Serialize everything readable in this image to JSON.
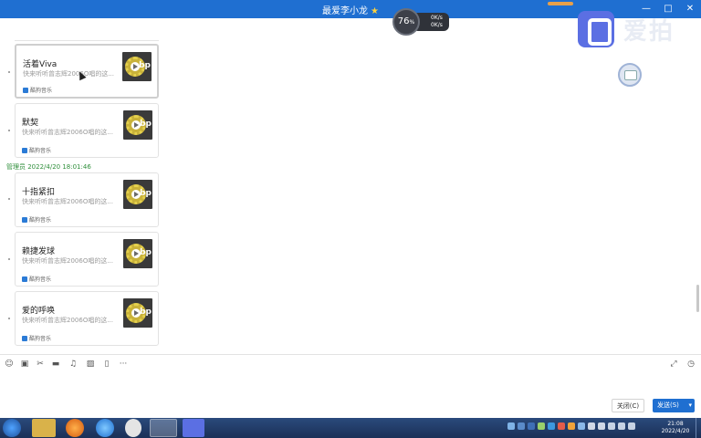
{
  "window": {
    "title": "最爱李小龙",
    "star": "★",
    "controls": [
      "—",
      "□",
      "✕"
    ]
  },
  "speed_widget": {
    "value": "76",
    "unit": "%",
    "up": "0K/s",
    "down": "0K/s"
  },
  "brand": {
    "name": "爱拍"
  },
  "chat": {
    "sender_time": "管理员 2022/4/20 18:01:46",
    "cards": [
      {
        "title": "活着Viva",
        "desc": "快来听听曾志辉2006O唱的这...",
        "source": "酷狗音乐"
      },
      {
        "title": "默契",
        "desc": "快来听听曾志辉2006O唱的这...",
        "source": "酷狗音乐"
      },
      {
        "title": "十指紧扣",
        "desc": "快来听听曾志辉2006O唱的这...",
        "source": "酷狗音乐"
      },
      {
        "title": "赖捷发球",
        "desc": "快来听听曾志辉2006O唱的这...",
        "source": "酷狗音乐"
      },
      {
        "title": "爱的呼唤",
        "desc": "快来听听曾志辉2006O唱的这...",
        "source": "酷狗音乐"
      }
    ],
    "thumb_label": "bp"
  },
  "toolbar": {
    "icons": [
      "emoji-icon",
      "gif-icon",
      "scissors-icon",
      "folder-icon",
      "music-icon",
      "image-icon",
      "phone-icon",
      "more-icon",
      "expand-icon",
      "history-icon"
    ],
    "more": "···"
  },
  "buttons": {
    "close": "关闭(C)",
    "send": "发送(S)",
    "send_caret": "▾"
  },
  "taskbar": {
    "time": "21:08",
    "date": "2022/4/20"
  },
  "colors": {
    "accent": "#1f6fd1",
    "sender": "#2f8f3b",
    "taskbar": "#1b3057"
  }
}
